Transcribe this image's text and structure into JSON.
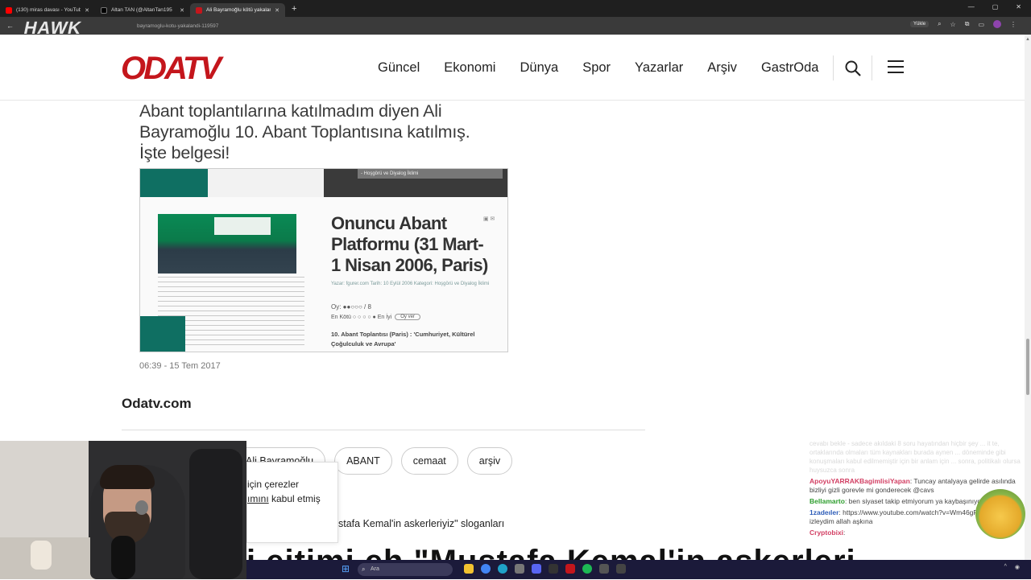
{
  "browser": {
    "tabs": [
      {
        "title": "(130) miras davası - YouTube",
        "favicon_color": "#ff0000",
        "active": false
      },
      {
        "title": "Altan TAN (@AltanTan195",
        "favicon_color": "#000000",
        "active": false
      },
      {
        "title": "Ali Bayramoğlu kötü yakalandı",
        "favicon_color": "#c4161c",
        "active": true
      }
    ],
    "new_tab": "+",
    "url": "bayramoglu-kotu-yakalandi-119597",
    "install_label": "Yükle"
  },
  "stream_overlay": {
    "logo_text": "HAWK"
  },
  "site": {
    "logo_text": "ODATV",
    "logo_color": "#c4161c",
    "nav": [
      "Güncel",
      "Ekonomi",
      "Dünya",
      "Spor",
      "Yazarlar",
      "Arşiv",
      "GastrOda"
    ]
  },
  "article": {
    "headline_lines": [
      "Abant toplantılarına katılmadım diyen Ali",
      "Bayramoğlu 10. Abant Toplantısına katılmış.",
      "İşte belgesi!"
    ],
    "date": "06:39 - 15 Tem 2017",
    "embedded_image": {
      "dropdown": "- Hoşgörü ve Diyalog İklimi",
      "title_lines": [
        "Onuncu Abant",
        "Platformu (31 Mart-",
        "1 Nisan 2006, Paris)"
      ],
      "meta": "Yazar: fgurer.com Tarih: 10 Eylül 2006 Kategori: Hoşgörü ve Diyalog İklimi",
      "rating": "Oy: ●●○○○ / 8",
      "vote_label": "En Kötü ○ ○ ○ ○ ● En İyi",
      "vote_button": "Oy ver",
      "subtitle_lines": [
        "10. Abant Toplantısı (Paris) : 'Cumhuriyet, Kültürel",
        "Çoğulculuk ve Avrupa'"
      ]
    },
    "source": "Odatv.com",
    "tags": [
      "Ali Bayramoğlu",
      "ABANT",
      "cemaat",
      "arşiv"
    ],
    "related_title": "stafa Kemal'in askerleriyiz\" sloganları",
    "big_headline": "i eitimi eh \"Mustafa Kemal'in askerleri"
  },
  "cookie": {
    "line1": "için çerezler",
    "link": "ımını",
    "line2": " kabul etmiş"
  },
  "chat": {
    "faded_text": "cevabı bekle - sadece akıldaki 8 soru hayatından hiçbir şey ... it te, ortaklarında olmaları tüm kaynakları burada aynen ... döneminde gibi konuşmaları kabul edilmemiştir için bir anlam için ... sonra, politikalı olursa huysuzca sonra",
    "messages": [
      {
        "user": "ApoyuYARRAKBagimlisiYapan",
        "color": "red",
        "text": ": Tuncay antalyaya gelirde asılında bizliyi gizli gorevle mi gonderecek @cavs"
      },
      {
        "user": "Bellamarto",
        "color": "green",
        "text": ": ben siyaset takip etmiyorum ya kaybaşınıyor muyor bana"
      },
      {
        "user": "1zadeıler",
        "color": "blue",
        "text": ": https://www.youtube.com/watch?v=Wm46gRy-kg bunu izleydim allah aşkına"
      },
      {
        "user": "Cryptobixi",
        "color": "red",
        "text": ":"
      }
    ]
  },
  "taskbar": {
    "search_placeholder": "Ara"
  }
}
